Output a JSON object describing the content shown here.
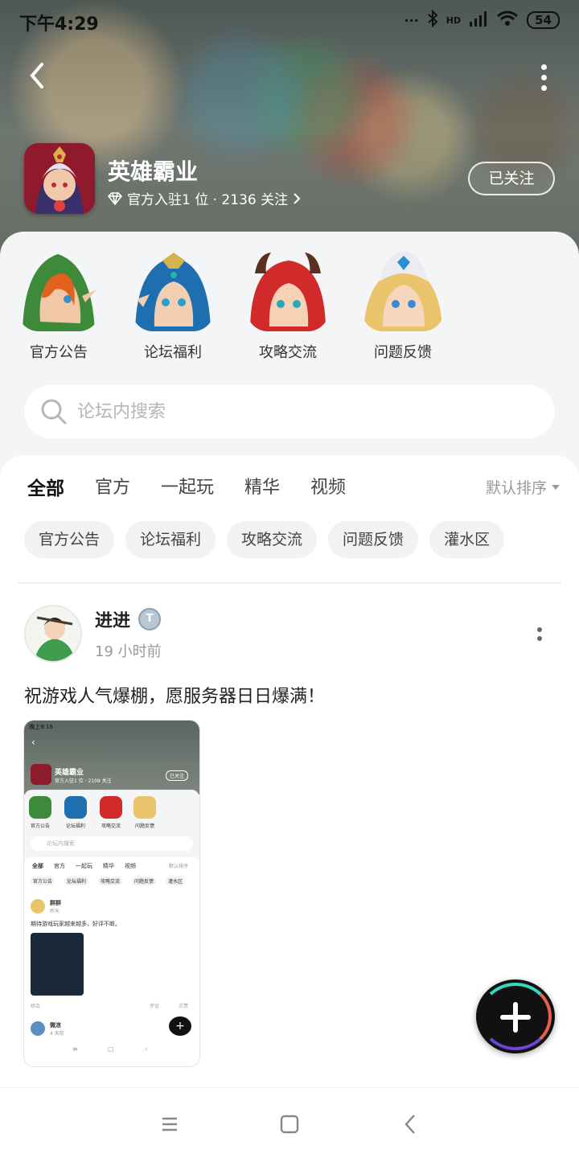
{
  "status_bar": {
    "time": "下午4:29",
    "network": "HD",
    "battery": "54"
  },
  "header": {
    "app_name": "英雄霸业",
    "subtitle": "官方入驻1 位 · 2136 关注",
    "follow_label": "已关注"
  },
  "forums": [
    {
      "label": "官方公告"
    },
    {
      "label": "论坛福利"
    },
    {
      "label": "攻略交流"
    },
    {
      "label": "问题反馈"
    }
  ],
  "search": {
    "placeholder": "论坛内搜索"
  },
  "tabs": [
    {
      "label": "全部",
      "active": true
    },
    {
      "label": "官方"
    },
    {
      "label": "一起玩"
    },
    {
      "label": "精华"
    },
    {
      "label": "视频"
    }
  ],
  "sort_label": "默认排序",
  "chips": [
    "官方公告",
    "论坛福利",
    "攻略交流",
    "问题反馈",
    "灌水区"
  ],
  "post": {
    "author": "进进",
    "badge": "T",
    "time": "19 小时前",
    "text": "祝游戏人气爆棚，愿服务器日日爆满！",
    "thumbnail": {
      "status_time": "晚上9:18",
      "app_name": "英雄霸业",
      "subtitle": "官方入驻1 位 · 2109 关注",
      "follow_label": "已关注",
      "forums": [
        "官方公告",
        "论坛福利",
        "攻略交流",
        "问题反馈"
      ],
      "search_placeholder": "论坛内搜索",
      "tabs": [
        "全部",
        "官方",
        "一起玩",
        "精华",
        "视频"
      ],
      "sort_label": "默认排序",
      "chips": [
        "官方公告",
        "论坛福利",
        "攻略交流",
        "问题反馈",
        "灌水区"
      ],
      "post1_author": "群群",
      "post1_time": "昨天",
      "post1_text": "期待游戏玩家越来越多，好评不断。",
      "tag": "综合",
      "comment_label": "评论",
      "like_label": "点赞",
      "post2_author": "微凉",
      "post2_time": "4 天前"
    }
  },
  "colors": {
    "accent": "#2fd3b1",
    "panel_bg": "#f4f5f7",
    "chip_bg": "#f1f2f4"
  }
}
